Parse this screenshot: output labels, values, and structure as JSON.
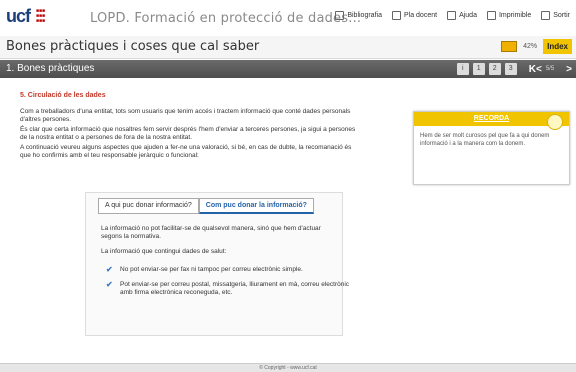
{
  "header": {
    "logo": "ucf",
    "course_title": "LOPD. Formació en protecció de dades...",
    "links": [
      {
        "label": "Bibliografia",
        "icon": "book-icon"
      },
      {
        "label": "Pla docent",
        "icon": "plan-icon"
      },
      {
        "label": "Ajuda",
        "icon": "help-icon"
      },
      {
        "label": "Imprimible",
        "icon": "print-icon"
      },
      {
        "label": "Sortir",
        "icon": "exit-icon"
      }
    ]
  },
  "page": {
    "title": "Bones pràctiques i coses que cal saber",
    "progress": "42%",
    "index_label": "Index"
  },
  "section": {
    "title": "1. Bones pràctiques",
    "pages": "5/5"
  },
  "content": {
    "heading": "5. Circulació de les dades",
    "p1": "Com a treballadors d'una entitat, tots som usuaris que tenim accés i tractem informació que conté dades personals d'altres persones.",
    "p2": "És clar que certa informació que nosaltres fem servir després l'hem d'enviar a terceres persones, ja sigui a persones de la nostra entitat o a persones de fora de la nostra entitat.",
    "p3": "A continuació veureu alguns aspectes que ajuden a fer-ne una valoració, si bé, en cas de dubte, la recomanació és que ho confirmis amb el teu responsable jeràrquic o funcional:",
    "tabs": [
      {
        "label": "A qui puc donar informació?",
        "active": false
      },
      {
        "label": "Com puc donar la informació?",
        "active": true
      }
    ],
    "tab_p1": "La informació no pot facilitar-se de qualsevol manera, sinó que hem d'actuar segons la normativa.",
    "tab_p2": "La informació que contingui dades de salut:",
    "checks": [
      "No pot enviar-se per fax ni tampoc per correu electrònic simple.",
      "Pot enviar-se per correu postal, missatgeria, lliurament en mà, correu electrònic amb firma electrònica reconeguda, etc."
    ]
  },
  "recorda": {
    "title": "RECORDA",
    "text": "Hem de ser molt curosos pel que fa a qui donem informació i a la manera com la donem."
  },
  "footer": "© Copyright - www.ucf.cat",
  "colors": {
    "accent": "#f1c400",
    "heading": "#c0392b",
    "link": "#2563a8"
  }
}
